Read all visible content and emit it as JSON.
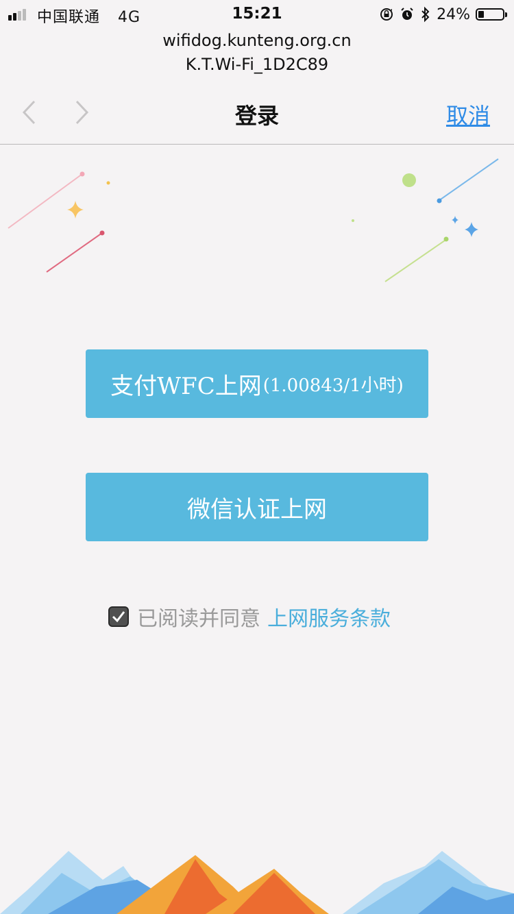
{
  "status_bar": {
    "carrier": "中国联通",
    "network": "4G",
    "time": "15:21",
    "battery_percent": "24%",
    "battery_level": 0.24
  },
  "address": {
    "host": "wifidog.kunteng.org.cn",
    "ssid": "K.T.Wi-Fi_1D2C89"
  },
  "nav": {
    "title": "登录",
    "cancel_label": "取消"
  },
  "buttons": {
    "pay_label": "支付WFC上网",
    "pay_price": "(1.00843/1小时)",
    "wechat_label": "微信认证上网"
  },
  "agreement": {
    "checked": true,
    "text": "已阅读并同意",
    "link_text": "上网服务条款"
  },
  "colors": {
    "background": "#f5f3f4",
    "button": "#58b9de",
    "link": "#2f8be6",
    "terms_link": "#4aaedb"
  }
}
